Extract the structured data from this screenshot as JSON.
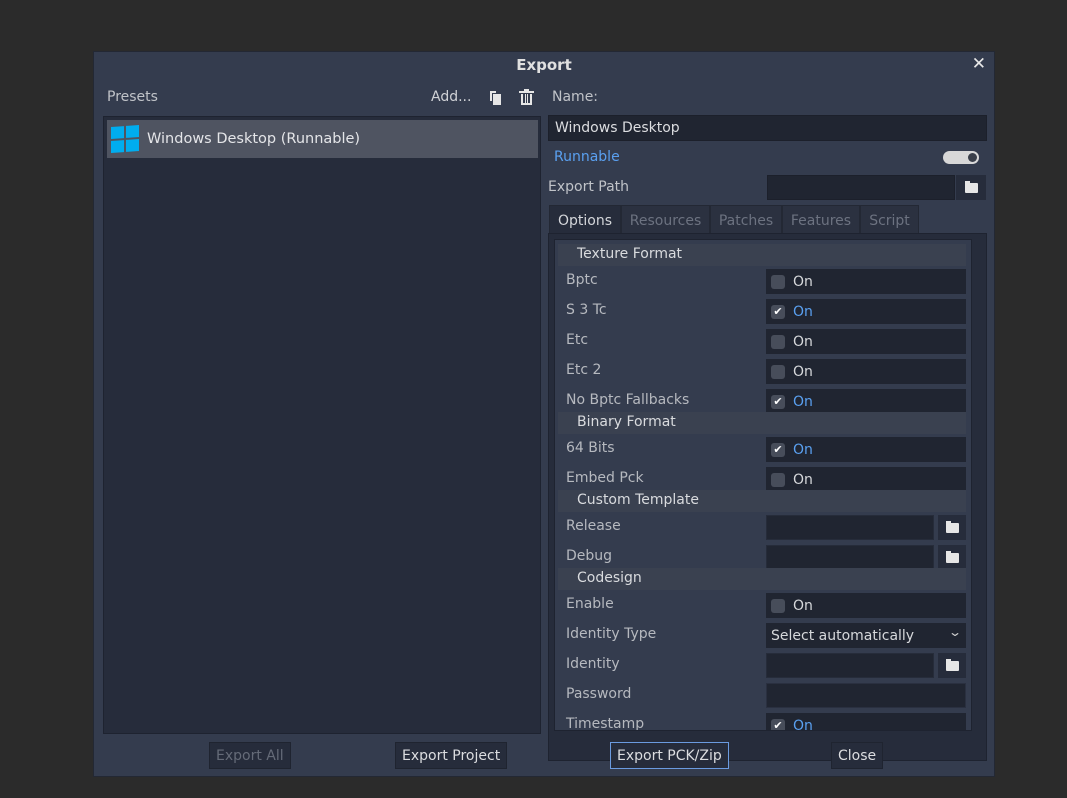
{
  "dialog": {
    "title": "Export",
    "close_icon": "close-icon"
  },
  "presets": {
    "label": "Presets",
    "add_label": "Add...",
    "items": [
      {
        "label": "Windows Desktop (Runnable)",
        "icon": "windows-logo-icon",
        "selected": true
      }
    ]
  },
  "preset_form": {
    "name_label": "Name:",
    "name_value": "Windows Desktop",
    "runnable_label": "Runnable",
    "runnable_on": true,
    "export_path_label": "Export Path",
    "export_path_value": ""
  },
  "tabs": [
    {
      "label": "Options",
      "active": true
    },
    {
      "label": "Resources"
    },
    {
      "label": "Patches"
    },
    {
      "label": "Features"
    },
    {
      "label": "Script"
    }
  ],
  "options": {
    "texture_format": "Texture Format",
    "bptc": {
      "label": "Bptc",
      "value": "On",
      "checked": false
    },
    "s3tc": {
      "label": "S 3 Tc",
      "value": "On",
      "checked": true
    },
    "etc": {
      "label": "Etc",
      "value": "On",
      "checked": false
    },
    "etc2": {
      "label": "Etc 2",
      "value": "On",
      "checked": false
    },
    "no_bptc": {
      "label": "No Bptc Fallbacks",
      "value": "On",
      "checked": true
    },
    "binary_format": "Binary Format",
    "bits64": {
      "label": "64 Bits",
      "value": "On",
      "checked": true
    },
    "embed_pck": {
      "label": "Embed Pck",
      "value": "On",
      "checked": false
    },
    "custom_template": "Custom Template",
    "release": {
      "label": "Release",
      "value": ""
    },
    "debug": {
      "label": "Debug",
      "value": ""
    },
    "codesign": "Codesign",
    "enable": {
      "label": "Enable",
      "value": "On",
      "checked": false
    },
    "identity_type": {
      "label": "Identity Type",
      "value": "Select automatically"
    },
    "identity": {
      "label": "Identity",
      "value": ""
    },
    "password": {
      "label": "Password",
      "value": ""
    },
    "timestamp": {
      "label": "Timestamp",
      "value": "On",
      "checked": true
    }
  },
  "buttons": {
    "export_all": "Export All",
    "export_project": "Export Project",
    "export_pck": "Export PCK/Zip",
    "close": "Close"
  },
  "colors": {
    "accent": "#5aa0f0",
    "windows_logo": "#00adef"
  }
}
